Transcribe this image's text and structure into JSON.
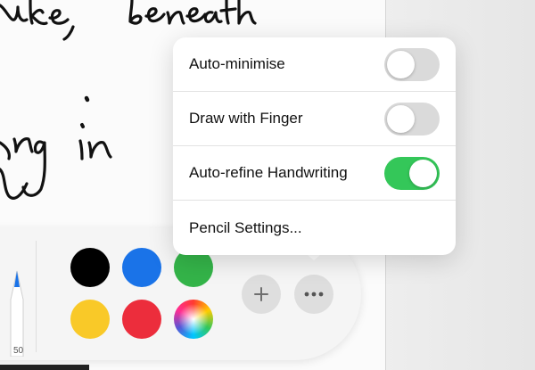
{
  "canvas": {
    "handwriting_lines": [
      "ake, beneath",
      "ing in"
    ]
  },
  "menu": {
    "items": [
      {
        "label": "Auto-minimise",
        "type": "toggle",
        "on": false
      },
      {
        "label": "Draw with Finger",
        "type": "toggle",
        "on": false
      },
      {
        "label": "Auto-refine Handwriting",
        "type": "toggle",
        "on": true
      },
      {
        "label": "Pencil Settings...",
        "type": "link"
      }
    ]
  },
  "toolbar": {
    "pencil_label": "50",
    "colors": [
      {
        "name": "black",
        "hex": "#000000"
      },
      {
        "name": "blue",
        "hex": "#1a73e8"
      },
      {
        "name": "green",
        "hex": "#34b449"
      },
      {
        "name": "yellow",
        "hex": "#f9c928"
      },
      {
        "name": "red",
        "hex": "#ec2d3c"
      },
      {
        "name": "color-picker",
        "hex": "multicolor"
      }
    ],
    "add_icon": "plus-icon",
    "more_icon": "more-icon"
  },
  "colors": {
    "toggle_on": "#34c759",
    "toggle_off": "#dadada"
  }
}
